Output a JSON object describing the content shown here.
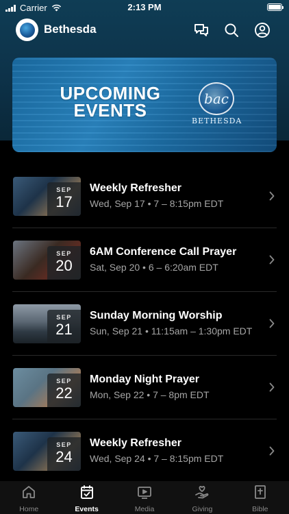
{
  "status_bar": {
    "carrier": "Carrier",
    "time": "2:13 PM"
  },
  "header": {
    "app_name": "Bethesda"
  },
  "banner": {
    "title_line1": "UPCOMING",
    "title_line2": "EVENTS",
    "emblem_text": "bac",
    "brand": "BETHESDA"
  },
  "events": [
    {
      "month": "SEP",
      "day": "17",
      "title": "Weekly Refresher",
      "subtitle": "Wed, Sep 17 • 7 – 8:15pm EDT",
      "thumbnail": "bible"
    },
    {
      "month": "SEP",
      "day": "20",
      "title": "6AM Conference Call Prayer",
      "subtitle": "Sat, Sep 20 • 6 – 6:20am EDT",
      "thumbnail": "car"
    },
    {
      "month": "SEP",
      "day": "21",
      "title": "Sunday Morning Worship",
      "subtitle": "Sun, Sep 21 • 11:15am – 1:30pm EDT",
      "thumbnail": "mountain"
    },
    {
      "month": "SEP",
      "day": "22",
      "title": "Monday Night Prayer",
      "subtitle": "Mon, Sep 22 • 7 – 8pm EDT",
      "thumbnail": "hands"
    },
    {
      "month": "SEP",
      "day": "24",
      "title": "Weekly Refresher",
      "subtitle": "Wed, Sep 24 • 7 – 8:15pm EDT",
      "thumbnail": "bible"
    }
  ],
  "tab_bar": {
    "active": "Events",
    "tabs": [
      {
        "label": "Home",
        "icon": "home-icon"
      },
      {
        "label": "Events",
        "icon": "calendar-check-icon"
      },
      {
        "label": "Media",
        "icon": "play-icon"
      },
      {
        "label": "Giving",
        "icon": "hand-heart-icon"
      },
      {
        "label": "Bible",
        "icon": "bible-cross-icon"
      }
    ]
  },
  "colors": {
    "background": "#000000",
    "header_gradient": "#0f3d55",
    "banner_blue": "#2a86c2",
    "muted_text": "#a6a6a6",
    "tab_inactive": "#8a8a8a"
  }
}
